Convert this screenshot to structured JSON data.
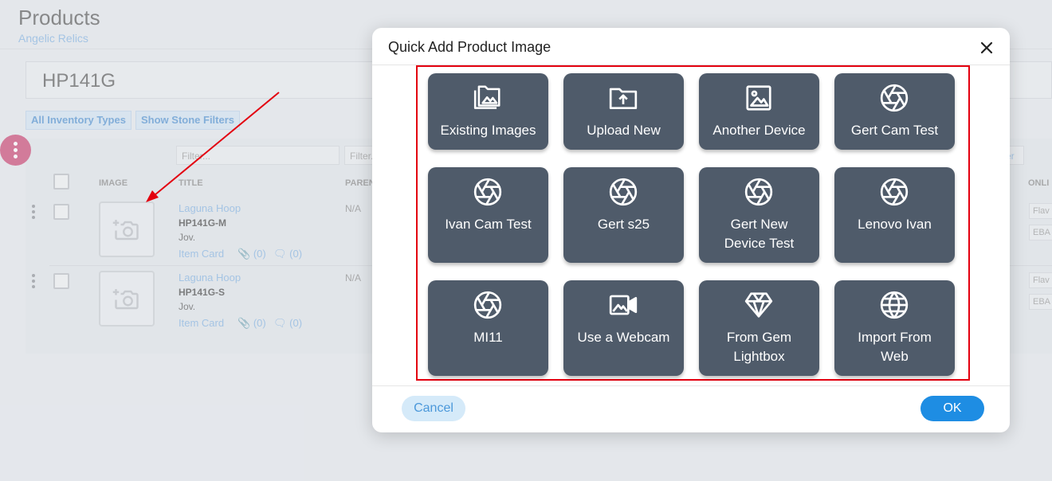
{
  "page": {
    "title": "Products",
    "subtitle": "Angelic Relics",
    "search_value": "HP141G",
    "filters": {
      "inventory_types": "All Inventory Types",
      "stone_filters": "Show Stone Filters"
    },
    "grid": {
      "filter_placeholder_1": "Filter...",
      "filter_placeholder_2": "Filter.",
      "filter_placeholder_3": "er",
      "columns": [
        "IMAGE",
        "TITLE",
        "PAREN",
        "ONLI"
      ],
      "rows": [
        {
          "title": "Laguna Hoop",
          "sku": "HP141G-M",
          "type": "Jov.",
          "parent": "N/A",
          "item_card": "Item Card",
          "attachments": "(0)",
          "comments": "(0)",
          "tags": [
            "Flav",
            "EBA"
          ]
        },
        {
          "title": "Laguna Hoop",
          "sku": "HP141G-S",
          "type": "Jov.",
          "parent": "N/A",
          "item_card": "Item Card",
          "attachments": "(0)",
          "comments": "(0)",
          "tags": [
            "Flav",
            "EBA"
          ]
        }
      ]
    }
  },
  "dialog": {
    "title": "Quick Add Product Image",
    "tiles": [
      {
        "label": "Existing Images",
        "icon": "images-folder-icon"
      },
      {
        "label": "Upload New",
        "icon": "upload-folder-icon"
      },
      {
        "label": "Another Device",
        "icon": "picture-icon"
      },
      {
        "label": "Gert Cam Test",
        "icon": "camera-aperture-icon"
      },
      {
        "label": "Ivan Cam Test",
        "icon": "camera-aperture-icon"
      },
      {
        "label": "Gert s25",
        "icon": "camera-aperture-icon"
      },
      {
        "label": "Gert New Device Test",
        "icon": "camera-aperture-icon"
      },
      {
        "label": "Lenovo Ivan",
        "icon": "camera-aperture-icon"
      },
      {
        "label": "MI11",
        "icon": "camera-aperture-icon"
      },
      {
        "label": "Use a Webcam",
        "icon": "video-camera-icon"
      },
      {
        "label": "From Gem Lightbox",
        "icon": "gem-icon"
      },
      {
        "label": "Import From Web",
        "icon": "globe-icon"
      }
    ],
    "cancel_label": "Cancel",
    "ok_label": "OK"
  },
  "colors": {
    "tile_bg": "#4f5b6a",
    "highlight": "#e3000f",
    "ok_bg": "#1e8de3",
    "link": "#82b1e0",
    "fab": "#c8416f"
  }
}
